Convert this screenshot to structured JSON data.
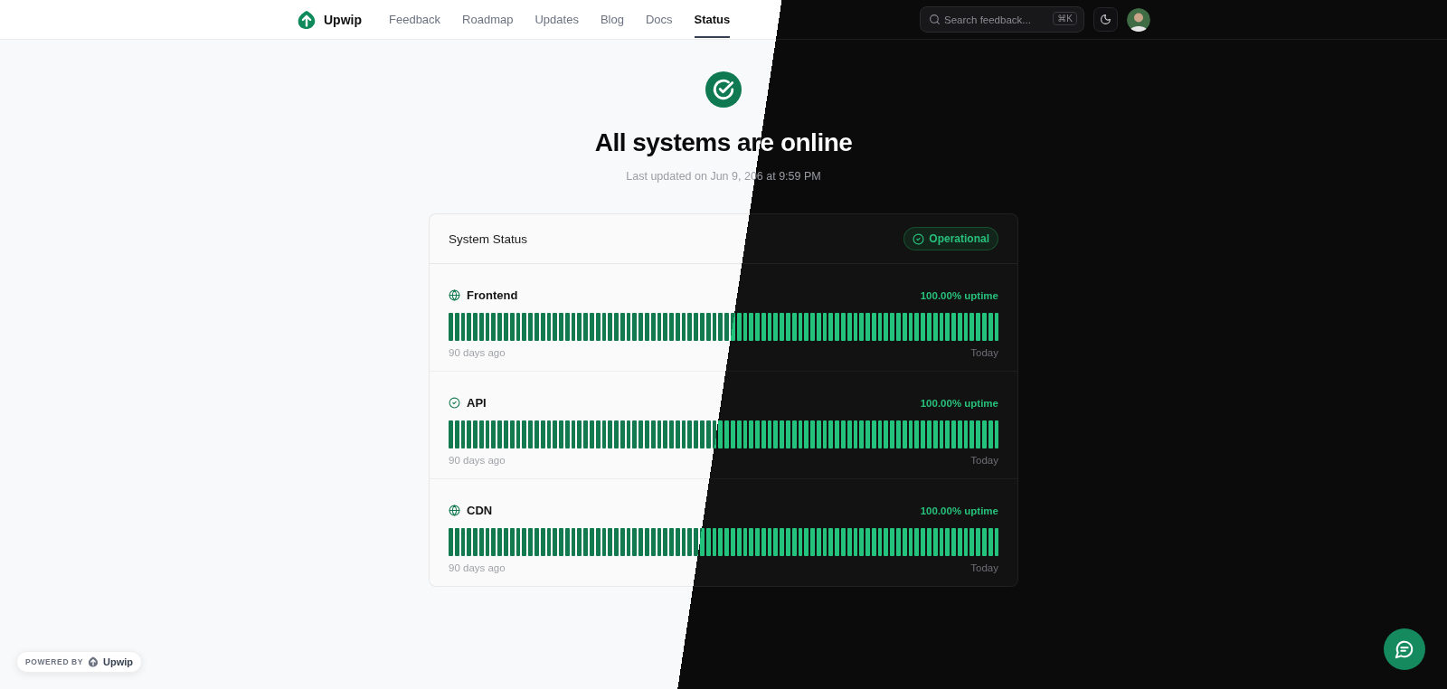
{
  "nav": {
    "brand": "Upwip",
    "links": [
      {
        "label": "Feedback",
        "selected": false
      },
      {
        "label": "Roadmap",
        "selected": false
      },
      {
        "label": "Updates",
        "selected": false
      },
      {
        "label": "Blog",
        "selected": false
      },
      {
        "label": "Docs",
        "selected": false
      },
      {
        "label": "Status",
        "selected": true
      }
    ],
    "search": {
      "placeholder": "Search feedback...",
      "shortcut": "⌘K"
    }
  },
  "hero": {
    "title": "All systems are online",
    "updated": "Last updated on Jun 9, 206 at 9:59 PM"
  },
  "card": {
    "title": "System Status",
    "badge": {
      "label": "Operational"
    },
    "services": [
      {
        "name": "Frontend",
        "kind": "globe",
        "uptime": "100.00% uptime",
        "start": "90 days ago",
        "end": "Today"
      },
      {
        "name": "API",
        "kind": "check",
        "uptime": "100.00% uptime",
        "start": "90 days ago",
        "end": "Today"
      },
      {
        "name": "CDN",
        "kind": "globe",
        "uptime": "100.00% uptime",
        "start": "90 days ago",
        "end": "Today"
      }
    ]
  },
  "footer": {
    "powered_by": "POWERED BY",
    "brand": "Upwip"
  }
}
